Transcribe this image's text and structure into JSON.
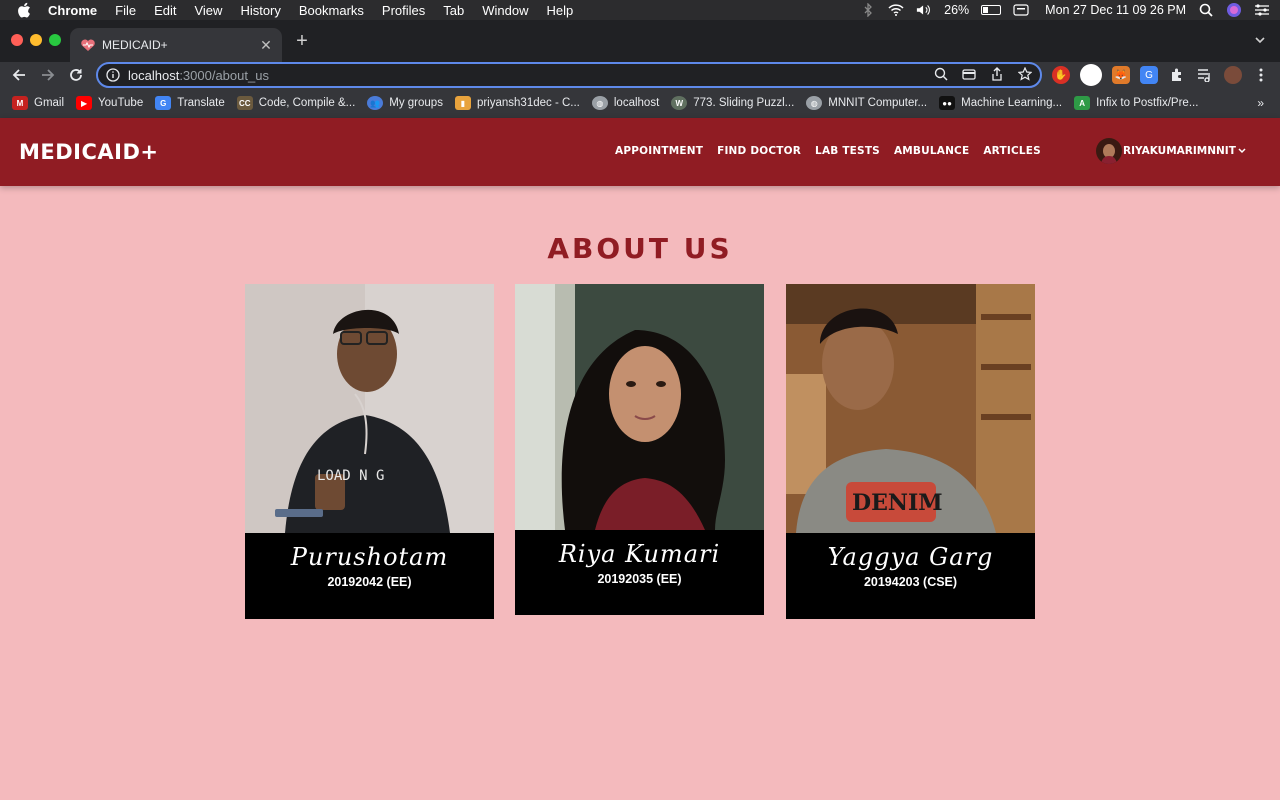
{
  "menubar": {
    "app": "Chrome",
    "items": [
      "File",
      "Edit",
      "View",
      "History",
      "Bookmarks",
      "Profiles",
      "Tab",
      "Window",
      "Help"
    ],
    "battery": "26%",
    "clock": "Mon 27 Dec  11 09 26 PM"
  },
  "browser": {
    "tab_title": "MEDICAID+",
    "url_host": "localhost",
    "url_path": ":3000/about_us",
    "bookmarks": [
      {
        "label": "Gmail",
        "color": "#c5221f",
        "icon": "gmail-icon"
      },
      {
        "label": "YouTube",
        "color": "#ff0000",
        "icon": "youtube-icon"
      },
      {
        "label": "Translate",
        "color": "#4285f4",
        "icon": "translate-icon"
      },
      {
        "label": "Code, Compile &...",
        "color": "#6b5a3e",
        "icon": "code-icon"
      },
      {
        "label": "My groups",
        "color": "#4a7bd8",
        "icon": "groups-icon"
      },
      {
        "label": "priyansh31dec - C...",
        "color": "#e8a33d",
        "icon": "chart-icon"
      },
      {
        "label": "localhost",
        "color": "#9aa0a6",
        "icon": "globe-icon"
      },
      {
        "label": "773. Sliding Puzzl...",
        "color": "#607060",
        "icon": "w-icon"
      },
      {
        "label": "MNNIT Computer...",
        "color": "#9aa0a6",
        "icon": "globe-icon"
      },
      {
        "label": "Machine Learning...",
        "color": "#111111",
        "icon": "medium-icon"
      },
      {
        "label": "Infix to Postfix/Pre...",
        "color": "#2e9a46",
        "icon": "android-icon"
      }
    ],
    "more_bookmarks": "»"
  },
  "site": {
    "brand": "MEDICAID+",
    "nav": [
      "APPOINTMENT",
      "FIND DOCTOR",
      "LAB TESTS",
      "AMBULANCE",
      "ARTICLES"
    ],
    "username": "RIYAKUMARIMNNIT",
    "heading": "ABOUT US",
    "team": [
      {
        "name": "Purushotam",
        "id": "20192042 (EE)"
      },
      {
        "name": "Riya Kumari",
        "id": "20192035 (EE)"
      },
      {
        "name": "Yaggya Garg",
        "id": "20194203 (CSE)"
      }
    ]
  },
  "colors": {
    "navbar": "#901c23",
    "page_bg": "#f4babd",
    "heading": "#901c23",
    "card_bg": "#000000"
  }
}
